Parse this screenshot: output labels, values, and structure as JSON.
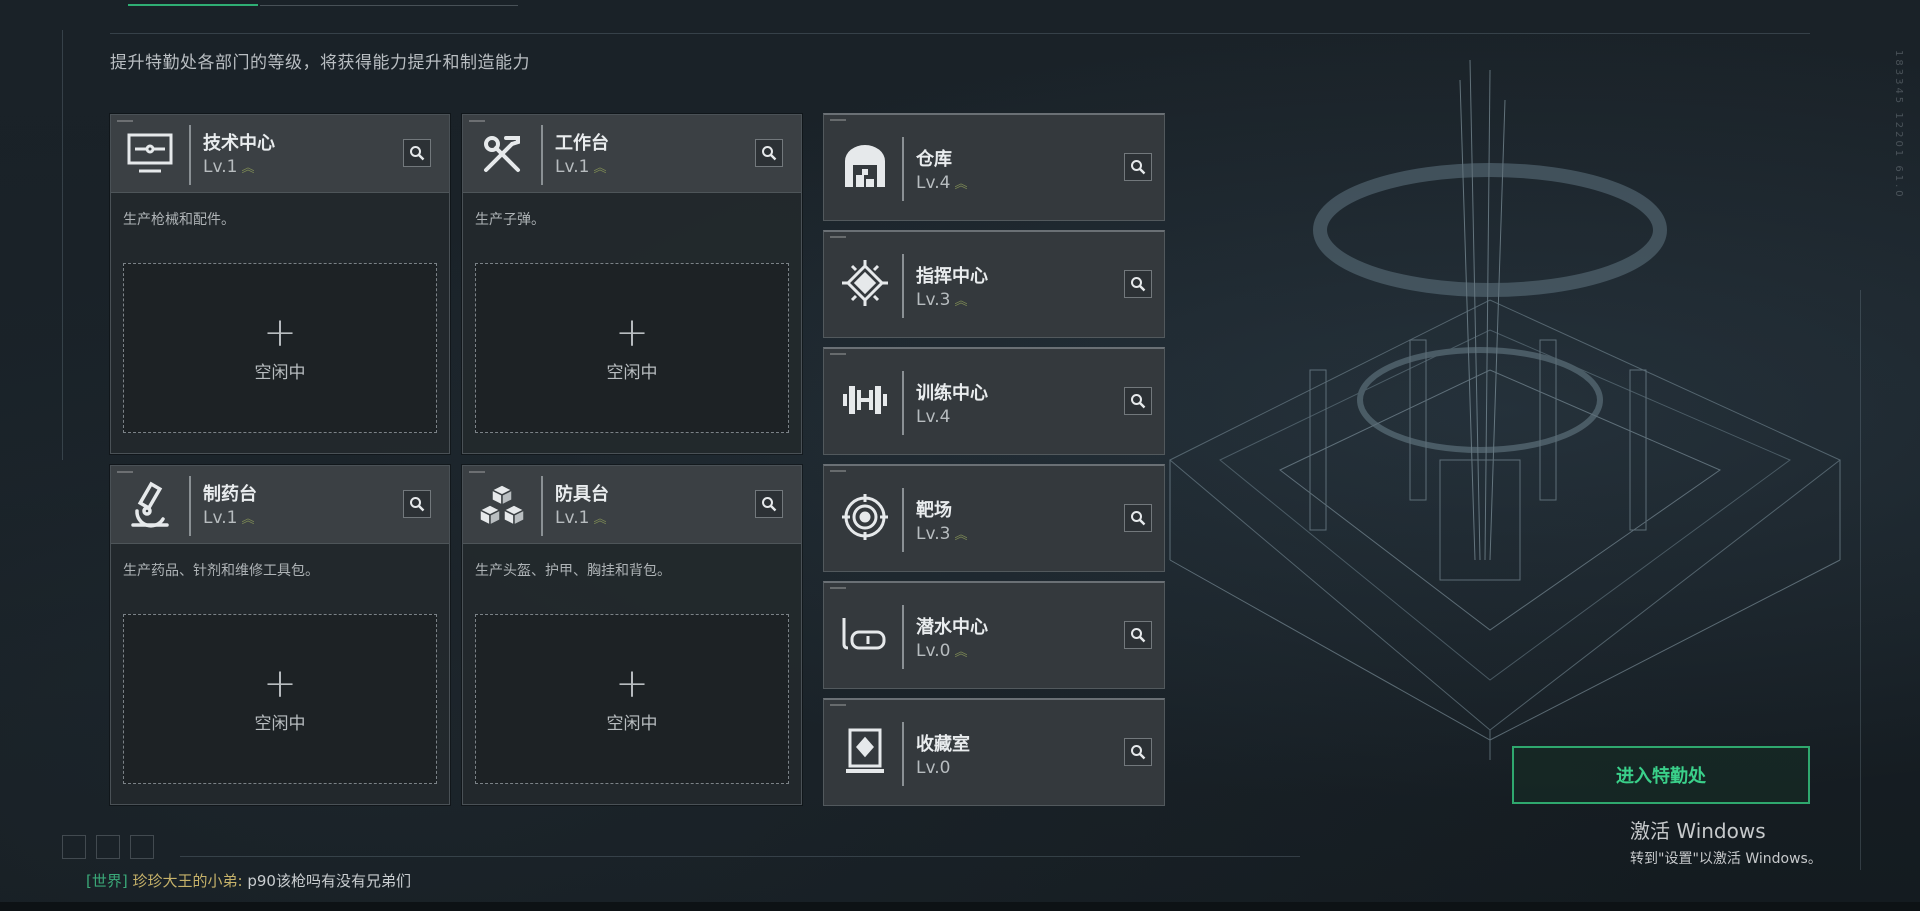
{
  "subtitle": "提升特勤处各部门的等级，将获得能力提升和制造能力",
  "main_cards": [
    {
      "name": "技术中心",
      "level": "Lv.1",
      "desc": "生产枪械和配件。",
      "slot_status": "空闲中",
      "icon": "computer-icon"
    },
    {
      "name": "工作台",
      "level": "Lv.1",
      "desc": "生产子弹。",
      "slot_status": "空闲中",
      "icon": "tools-icon"
    },
    {
      "name": "制药台",
      "level": "Lv.1",
      "desc": "生产药品、针剂和维修工具包。",
      "slot_status": "空闲中",
      "icon": "microscope-icon"
    },
    {
      "name": "防具台",
      "level": "Lv.1",
      "desc": "生产头盔、护甲、胸挂和背包。",
      "slot_status": "空闲中",
      "icon": "cubes-icon"
    }
  ],
  "side_cards": [
    {
      "name": "仓库",
      "level": "Lv.4",
      "upgradable": true,
      "icon": "warehouse-icon"
    },
    {
      "name": "指挥中心",
      "level": "Lv.3",
      "upgradable": true,
      "icon": "chip-icon"
    },
    {
      "name": "训练中心",
      "level": "Lv.4",
      "upgradable": false,
      "icon": "dumbbell-icon"
    },
    {
      "name": "靶场",
      "level": "Lv.3",
      "upgradable": true,
      "icon": "target-icon"
    },
    {
      "name": "潜水中心",
      "level": "Lv.0",
      "upgradable": true,
      "icon": "diving-mask-icon"
    },
    {
      "name": "收藏室",
      "level": "Lv.0",
      "upgradable": false,
      "icon": "display-case-icon"
    }
  ],
  "upgrade_marker": "︽",
  "plus_glyph": "+",
  "enter_button": "进入特勤处",
  "windows_activation": {
    "title": "激活 Windows",
    "subtitle": "转到\"设置\"以激活 Windows。"
  },
  "chat": {
    "channel": "[世界]",
    "sender": "珍珍大王的小弟:",
    "message": "p90该枪吗有没有兄弟们"
  },
  "colors": {
    "accent_green": "#2fa86e",
    "upgrade_chevron": "#7d8a55",
    "panel": "#3b4044"
  }
}
